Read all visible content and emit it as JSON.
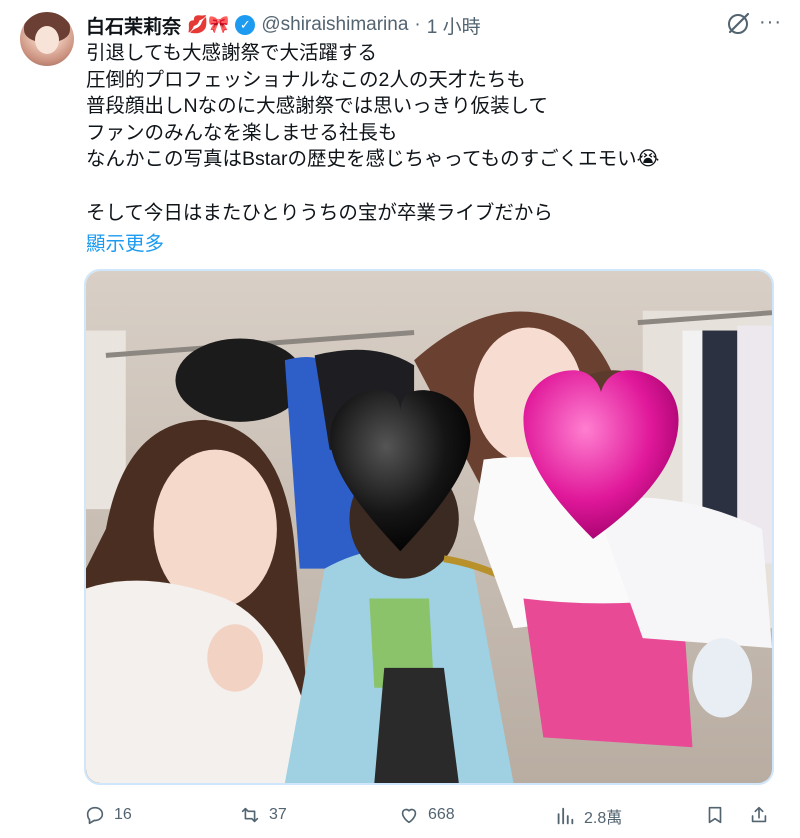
{
  "author": {
    "name": "白石茉莉奈",
    "emojis": "💋🎀",
    "handle": "@shiraishimarina",
    "separator": "·",
    "time": "1 小時"
  },
  "tweet": {
    "lines": [
      "引退しても大感謝祭で大活躍する",
      "圧倒的プロフェッショナルなこの2人の天才たちも",
      "普段顔出しNなのに大感謝祭では思いっきり仮装して",
      "ファンのみんなを楽しませる社長も",
      "なんかこの写真はBstarの歴史を感じちゃってものすごくエモい😭",
      "そして今日はまたひとりうちの宝が卒業ライブだから"
    ],
    "show_more": "顯示更多"
  },
  "actions": {
    "reply_count": "16",
    "retweet_count": "37",
    "like_count": "668",
    "views_count": "2.8萬"
  },
  "colors": {
    "accent": "#1d9bf0",
    "muted": "#536471",
    "heart_pink": "#e0189a",
    "heart_black": "#111111"
  }
}
